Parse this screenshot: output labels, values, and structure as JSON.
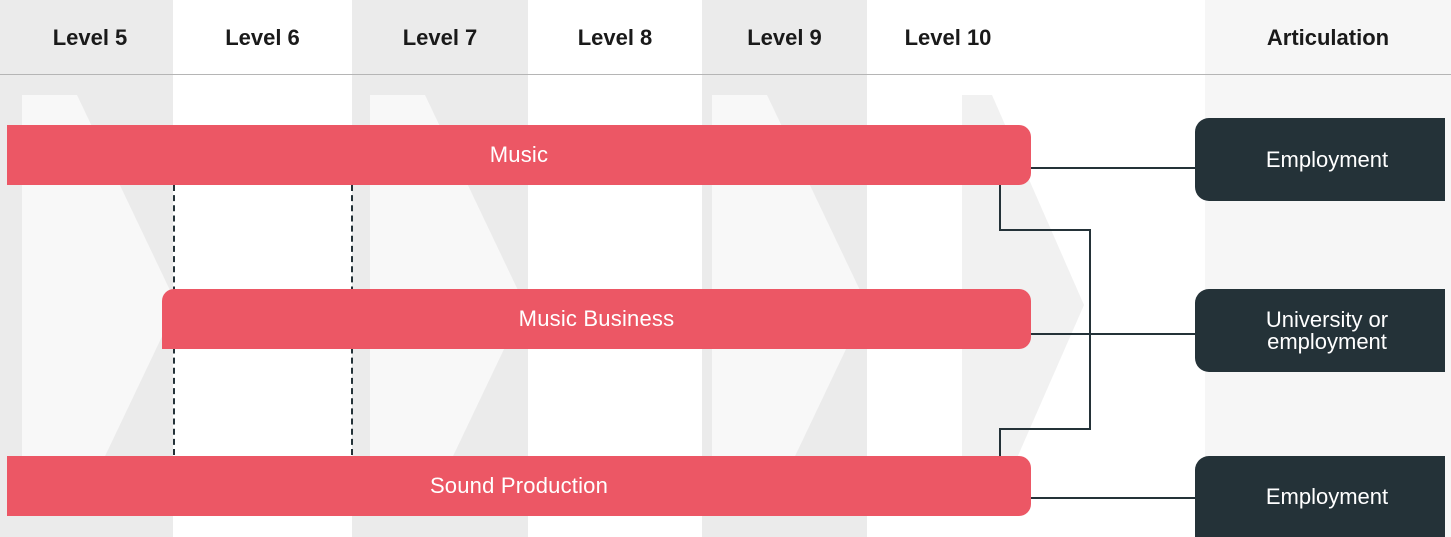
{
  "headers": {
    "level5": "Level 5",
    "level6": "Level 6",
    "level7": "Level 7",
    "level8": "Level 8",
    "level9": "Level 9",
    "level10": "Level 10",
    "articulation": "Articulation"
  },
  "pathways": [
    {
      "label": "Music"
    },
    {
      "label": "Music Business"
    },
    {
      "label": "Sound Production"
    }
  ],
  "outcomes": [
    {
      "label": "Employment"
    },
    {
      "label": "University or employment"
    },
    {
      "label": "Employment"
    }
  ],
  "colors": {
    "pathway_bar": "#ec5765",
    "outcome_box": "#243238",
    "column_shade": "#ebebeb"
  }
}
